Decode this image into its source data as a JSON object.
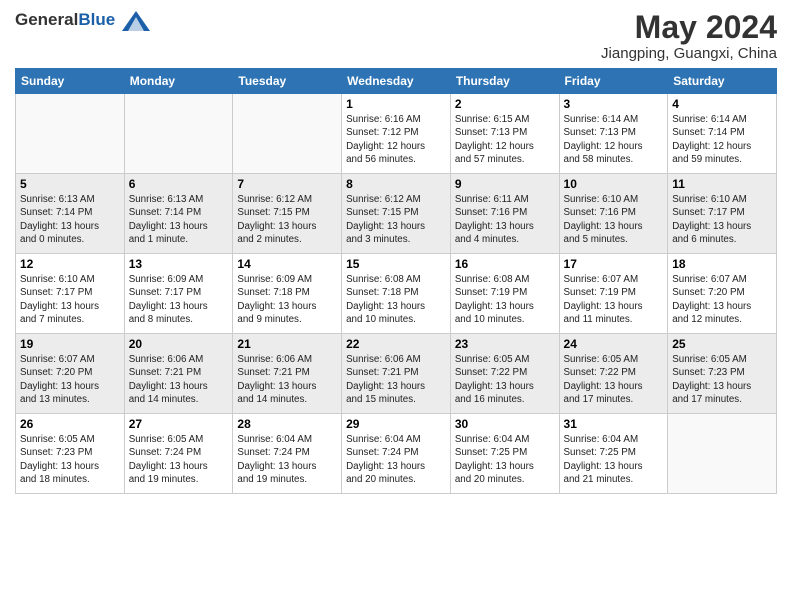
{
  "header": {
    "logo_general": "General",
    "logo_blue": "Blue",
    "month_title": "May 2024",
    "subtitle": "Jiangping, Guangxi, China"
  },
  "weekdays": [
    "Sunday",
    "Monday",
    "Tuesday",
    "Wednesday",
    "Thursday",
    "Friday",
    "Saturday"
  ],
  "weeks": [
    [
      {
        "date": "",
        "info": ""
      },
      {
        "date": "",
        "info": ""
      },
      {
        "date": "",
        "info": ""
      },
      {
        "date": "1",
        "info": "Sunrise: 6:16 AM\nSunset: 7:12 PM\nDaylight: 12 hours\nand 56 minutes."
      },
      {
        "date": "2",
        "info": "Sunrise: 6:15 AM\nSunset: 7:13 PM\nDaylight: 12 hours\nand 57 minutes."
      },
      {
        "date": "3",
        "info": "Sunrise: 6:14 AM\nSunset: 7:13 PM\nDaylight: 12 hours\nand 58 minutes."
      },
      {
        "date": "4",
        "info": "Sunrise: 6:14 AM\nSunset: 7:14 PM\nDaylight: 12 hours\nand 59 minutes."
      }
    ],
    [
      {
        "date": "5",
        "info": "Sunrise: 6:13 AM\nSunset: 7:14 PM\nDaylight: 13 hours\nand 0 minutes."
      },
      {
        "date": "6",
        "info": "Sunrise: 6:13 AM\nSunset: 7:14 PM\nDaylight: 13 hours\nand 1 minute."
      },
      {
        "date": "7",
        "info": "Sunrise: 6:12 AM\nSunset: 7:15 PM\nDaylight: 13 hours\nand 2 minutes."
      },
      {
        "date": "8",
        "info": "Sunrise: 6:12 AM\nSunset: 7:15 PM\nDaylight: 13 hours\nand 3 minutes."
      },
      {
        "date": "9",
        "info": "Sunrise: 6:11 AM\nSunset: 7:16 PM\nDaylight: 13 hours\nand 4 minutes."
      },
      {
        "date": "10",
        "info": "Sunrise: 6:10 AM\nSunset: 7:16 PM\nDaylight: 13 hours\nand 5 minutes."
      },
      {
        "date": "11",
        "info": "Sunrise: 6:10 AM\nSunset: 7:17 PM\nDaylight: 13 hours\nand 6 minutes."
      }
    ],
    [
      {
        "date": "12",
        "info": "Sunrise: 6:10 AM\nSunset: 7:17 PM\nDaylight: 13 hours\nand 7 minutes."
      },
      {
        "date": "13",
        "info": "Sunrise: 6:09 AM\nSunset: 7:17 PM\nDaylight: 13 hours\nand 8 minutes."
      },
      {
        "date": "14",
        "info": "Sunrise: 6:09 AM\nSunset: 7:18 PM\nDaylight: 13 hours\nand 9 minutes."
      },
      {
        "date": "15",
        "info": "Sunrise: 6:08 AM\nSunset: 7:18 PM\nDaylight: 13 hours\nand 10 minutes."
      },
      {
        "date": "16",
        "info": "Sunrise: 6:08 AM\nSunset: 7:19 PM\nDaylight: 13 hours\nand 10 minutes."
      },
      {
        "date": "17",
        "info": "Sunrise: 6:07 AM\nSunset: 7:19 PM\nDaylight: 13 hours\nand 11 minutes."
      },
      {
        "date": "18",
        "info": "Sunrise: 6:07 AM\nSunset: 7:20 PM\nDaylight: 13 hours\nand 12 minutes."
      }
    ],
    [
      {
        "date": "19",
        "info": "Sunrise: 6:07 AM\nSunset: 7:20 PM\nDaylight: 13 hours\nand 13 minutes."
      },
      {
        "date": "20",
        "info": "Sunrise: 6:06 AM\nSunset: 7:21 PM\nDaylight: 13 hours\nand 14 minutes."
      },
      {
        "date": "21",
        "info": "Sunrise: 6:06 AM\nSunset: 7:21 PM\nDaylight: 13 hours\nand 14 minutes."
      },
      {
        "date": "22",
        "info": "Sunrise: 6:06 AM\nSunset: 7:21 PM\nDaylight: 13 hours\nand 15 minutes."
      },
      {
        "date": "23",
        "info": "Sunrise: 6:05 AM\nSunset: 7:22 PM\nDaylight: 13 hours\nand 16 minutes."
      },
      {
        "date": "24",
        "info": "Sunrise: 6:05 AM\nSunset: 7:22 PM\nDaylight: 13 hours\nand 17 minutes."
      },
      {
        "date": "25",
        "info": "Sunrise: 6:05 AM\nSunset: 7:23 PM\nDaylight: 13 hours\nand 17 minutes."
      }
    ],
    [
      {
        "date": "26",
        "info": "Sunrise: 6:05 AM\nSunset: 7:23 PM\nDaylight: 13 hours\nand 18 minutes."
      },
      {
        "date": "27",
        "info": "Sunrise: 6:05 AM\nSunset: 7:24 PM\nDaylight: 13 hours\nand 19 minutes."
      },
      {
        "date": "28",
        "info": "Sunrise: 6:04 AM\nSunset: 7:24 PM\nDaylight: 13 hours\nand 19 minutes."
      },
      {
        "date": "29",
        "info": "Sunrise: 6:04 AM\nSunset: 7:24 PM\nDaylight: 13 hours\nand 20 minutes."
      },
      {
        "date": "30",
        "info": "Sunrise: 6:04 AM\nSunset: 7:25 PM\nDaylight: 13 hours\nand 20 minutes."
      },
      {
        "date": "31",
        "info": "Sunrise: 6:04 AM\nSunset: 7:25 PM\nDaylight: 13 hours\nand 21 minutes."
      },
      {
        "date": "",
        "info": ""
      }
    ]
  ]
}
